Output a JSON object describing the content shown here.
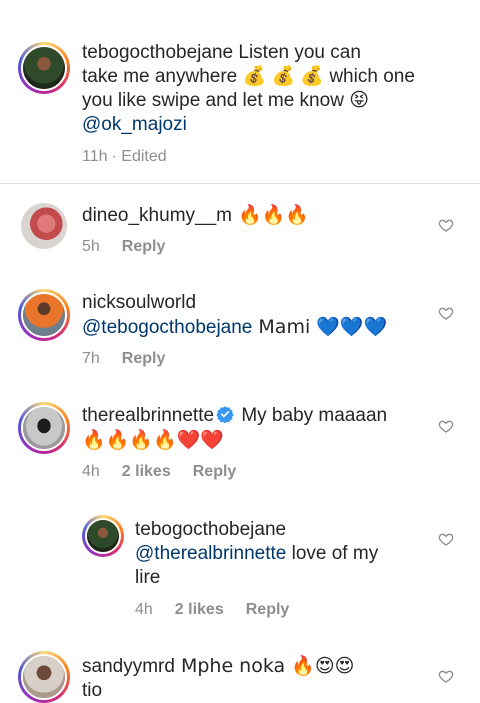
{
  "caption": {
    "username": "tebogocthobejane",
    "text_line1": " Listen you can",
    "text_line2": "take me anywhere 💰 💰 💰 which one",
    "text_line3": "you like swipe and let me know 😝",
    "mention": "@ok_majozi",
    "time": "11h",
    "edited": "· Edited"
  },
  "comments": [
    {
      "username": "dineo_khumy__m",
      "text": " 🔥🔥🔥",
      "time": "5h",
      "reply_label": "Reply"
    },
    {
      "username": "nicksoulworld",
      "mention": "@tebogocthobejane",
      "text": " Mami 💙💙💙",
      "time": "7h",
      "reply_label": "Reply"
    },
    {
      "username": "therealbrinnette",
      "text": " My baby maaaan",
      "text_line2": "🔥🔥🔥🔥❤️❤️",
      "time": "4h",
      "likes": "2 likes",
      "reply_label": "Reply"
    },
    {
      "username": "tebogocthobejane",
      "mention": "@therealbrinnette",
      "text": " love of my",
      "text_line2": "lire",
      "time": "4h",
      "likes": "2 likes",
      "reply_label": "Reply"
    },
    {
      "username": "sandyymrd",
      "text": " Mphe noka 🔥😍😍",
      "text_line2": "tio"
    }
  ],
  "icons": {
    "like": "heart-outline-icon",
    "verified": "verified-badge-icon"
  },
  "colors": {
    "mention": "#00376b",
    "meta": "#8e8e8e",
    "verified": "#3897f0"
  }
}
